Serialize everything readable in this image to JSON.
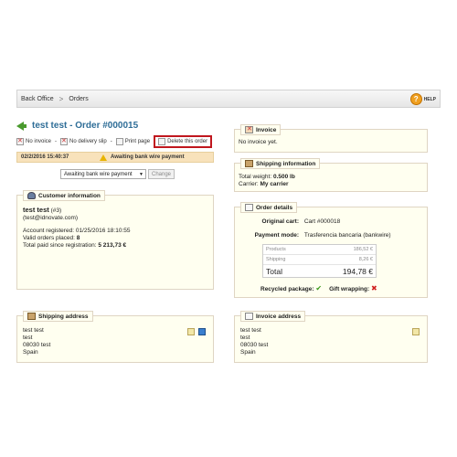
{
  "breadcrumb": {
    "root": "Back Office",
    "separator": ">",
    "current": "Orders"
  },
  "help": {
    "label": "HELP",
    "icon": "help-icon"
  },
  "order": {
    "title": "test test - Order #000015"
  },
  "actions": [
    {
      "label": "No invoice",
      "icon": "no-invoice-icon"
    },
    {
      "label": "No delivery slip",
      "icon": "no-delivery-slip-icon"
    },
    {
      "label": "Print page",
      "icon": "print-icon"
    },
    {
      "label": "Delete this order",
      "icon": "delete-icon"
    }
  ],
  "status": {
    "date": "02/2/2016 15:40:37",
    "text": "Awaiting bank wire payment"
  },
  "status_select": {
    "value": "Awaiting bank wire payment",
    "caret": "▼",
    "change_label": "Change"
  },
  "customer": {
    "legend": "Customer information",
    "name": "test test",
    "id_suffix": "(#3)",
    "email": "(test@idnovate.com)",
    "registered_label": "Account registered:",
    "registered_value": "01/25/2016 18:10:55",
    "valid_label": "Valid orders placed:",
    "valid_value": "8",
    "total_label": "Total paid since registration:",
    "total_value": "5 213,73 €"
  },
  "invoice_panel": {
    "legend": "Invoice",
    "text": "No invoice yet."
  },
  "shipping_info": {
    "legend": "Shipping information",
    "weight_label": "Total weight:",
    "weight_value": "0.500 lb",
    "carrier_label": "Carrier:",
    "carrier_value": "My carrier"
  },
  "order_details": {
    "legend": "Order details",
    "cart_label": "Original cart:",
    "cart_value": "Cart #000018",
    "payment_label": "Payment mode:",
    "payment_value": "Trasferencia bancaria (bankwire)",
    "rows": [
      {
        "label": "Products",
        "value": "186,52 €"
      },
      {
        "label": "Shipping",
        "value": "8,26 €"
      }
    ],
    "total_label": "Total",
    "total_value": "194,78 €",
    "recycled_label": "Recycled package:",
    "gift_label": "Gift wrapping:"
  },
  "shipping_address": {
    "legend": "Shipping address",
    "lines": [
      "test test",
      "test",
      "08030 test",
      "Spain"
    ]
  },
  "invoice_address": {
    "legend": "Invoice address",
    "lines": [
      "test test",
      "test",
      "08030 test",
      "Spain"
    ]
  }
}
